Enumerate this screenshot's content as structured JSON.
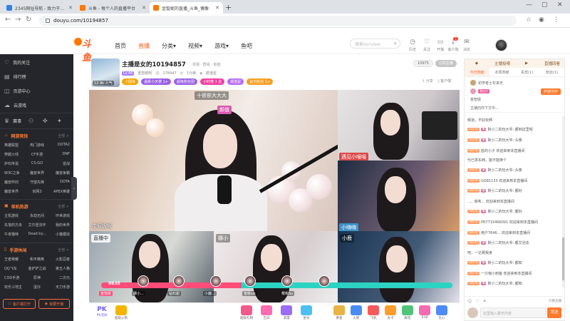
{
  "browser": {
    "tabs": [
      {
        "title": "2345网址导航 - 致力于打造百年品牌",
        "favicon_color": "#2f83e6"
      },
      {
        "title": "斗鱼 - 每个人的直播平台",
        "favicon_color": "#ff7700"
      },
      {
        "title": "金智妮的直播_斗鱼_偶像",
        "favicon_color": "#ff7700"
      }
    ],
    "active_tab": 2,
    "url": "douyu.com/10194857",
    "new_tab": "+"
  },
  "site": {
    "logo": "斗鱼",
    "nav": [
      "首页",
      "直播",
      "分类",
      "视频",
      "游戏",
      "鱼吧"
    ],
    "active_nav": 1,
    "search_placeholder": "搜索ourview",
    "header_icons": [
      "历史",
      "关注",
      "开播",
      "客户端",
      "消息"
    ],
    "msg_badge": "1"
  },
  "sidebar": {
    "top_items": [
      {
        "label": "我的关注",
        "icon": "heart-icon"
      },
      {
        "label": "排行榜",
        "icon": "rank-icon"
      },
      {
        "label": "页游中心",
        "icon": "gamepad-icon"
      },
      {
        "label": "云游戏",
        "icon": "cloud-icon"
      }
    ],
    "event_items": [
      "赛事",
      "",
      "",
      ""
    ],
    "categories": [
      {
        "title": "网游竞技",
        "more": "全部 >",
        "items": [
          "英雄联盟",
          "热门游戏",
          "DOTA2",
          "穿越火线",
          "CF手游",
          "DNF",
          "炉石传说",
          "CS:GO",
          "逆战",
          "W3C之争",
          "魔兽世界",
          "魔兽争霸",
          "魔兽怀旧",
          "守望先锋",
          "DOTA",
          "魔兽世界",
          "剑网3",
          "APEX英雄"
        ]
      },
      {
        "title": "单机热游",
        "more": "全部 >",
        "items": [
          "主机游戏",
          "永劫无间",
          "环世游戏",
          "失落的方舟",
          "艾尔登法环",
          "我的世界",
          "午夜猫咪",
          "Dead by...",
          "小猫模拟"
        ]
      },
      {
        "title": "手游休闲",
        "more": "全部 >",
        "items": [
          "王者荣耀",
          "和平精英",
          "火影忍者",
          "QQ飞车",
          "金铲铲之战",
          "第五人格",
          "COD手游",
          "原神",
          "二次元",
          "欢乐斗地主",
          "蛋仔",
          "天刀手游"
        ]
      }
    ],
    "buttons": [
      "客户端打开",
      "我要开播"
    ]
  },
  "room": {
    "anchor_tag": "12.9k 人气",
    "title": "主播是女的10194857",
    "links": [
      "举报",
      "群组",
      "颜值"
    ],
    "level": "Lv.46",
    "meta": [
      "金智妮呢",
      "278447",
      "1分钟",
      "颜值星"
    ],
    "tags": [
      {
        "label": "小团体",
        "color": "#f7a400"
      },
      {
        "label": "温柔小天使 1+",
        "color": "#9b62e6"
      },
      {
        "label": "超级粉丝团",
        "color": "#9b62e6"
      },
      {
        "label": "小时榜 1 名",
        "color": "#ef3fa0"
      },
      {
        "label": "颜值星",
        "color": "#b86af5"
      },
      {
        "label": "钻石粉丝 1+",
        "color": "#f5a021"
      }
    ],
    "right_pills": [
      "10975",
      "订阅主播"
    ],
    "actions": [
      "分享",
      "客户端",
      "举报"
    ]
  },
  "video": {
    "main_banner": "十依依大大大",
    "main_badge": "颜值",
    "main_label": "金智妮呢",
    "cell_labels": [
      "遇见小喵喵",
      "小嗨嗨",
      "直播中",
      "娜小",
      "小鹿",
      "小金"
    ],
    "pk_score": "8628",
    "pk_names": [
      "金智妮",
      "娜小...",
      "钻石甜",
      "小鹿...",
      "蜜桃sis",
      "樱桃Su"
    ]
  },
  "gifts": {
    "pk_label": "PK",
    "pk_sub": "PK活动",
    "items": [
      {
        "label": "超级火箭",
        "color": "#f6b400"
      },
      {
        "label": "超级礼物",
        "color": "#f25a8c"
      },
      {
        "label": "告白",
        "color": "#ff6bb0"
      },
      {
        "label": "浪漫",
        "color": "#9b6cf5"
      },
      {
        "label": "星光",
        "color": "#4cc0f1"
      },
      {
        "label": "黄金",
        "color": "#e8b245"
      },
      {
        "label": "火箭",
        "color": "#4a8cf5"
      },
      {
        "label": "飞机",
        "color": "#f55a5a"
      },
      {
        "label": "办卡",
        "color": "#ff9d2b"
      },
      {
        "label": "鲜花",
        "color": "#52c47a"
      },
      {
        "label": "618",
        "color": "#f56bb0"
      },
      {
        "label": "比心",
        "color": "#4f8bf7"
      },
      {
        "label": "更多",
        "color": "#ccc"
      }
    ]
  },
  "rpanel": {
    "top": [
      "主播投喂",
      "直播回看"
    ],
    "tabs": [
      "今日贡献",
      "本周贡献",
      "贵宾(1)",
      "粉丝(1)"
    ],
    "active_tab": 0,
    "rank_rows": [
      "初学者士年来无",
      "潘宝贝",
      "金智妮",
      "主播向你下方中..."
    ],
    "open_guard": "开通守护",
    "messages": [
      {
        "lv": "",
        "med": "",
        "name": "",
        "text": "频道，不好玩啊"
      },
      {
        "lv": "12/35",
        "med": "",
        "name": "",
        "text": "默小二的玩大爷: 都到这里啦"
      },
      {
        "lv": "18/35",
        "med": "",
        "name": "",
        "text": "默小二的玩大爷: 头像"
      },
      {
        "lv": "18/35",
        "med": "",
        "name": "",
        "text": "蓝的小子 欢迎来到本直播间"
      },
      {
        "lv": "",
        "med": "",
        "name": "",
        "text": "代已羡东西，能不能换个"
      },
      {
        "lv": "18/35",
        "med": "",
        "name": "",
        "text": "默小二的玩大爷: 头像"
      },
      {
        "lv": "18/35",
        "med": "",
        "name": "",
        "text": "GG81133 欢迎来到本直播间"
      },
      {
        "lv": "18/35",
        "med": "",
        "name": "",
        "text": "默小二的玩大爷: 都好"
      },
      {
        "lv": "",
        "med": "",
        "name": "",
        "text": "..... 真希... 欢迎来到本直播间"
      },
      {
        "lv": "18/35",
        "med": "",
        "name": "",
        "text": "默小二的玩大爷: 都好"
      },
      {
        "lv": "18/35",
        "med": "",
        "name": "",
        "text": "PR7715466091 欢迎来到本直播间"
      },
      {
        "lv": "18/35",
        "med": "",
        "name": "",
        "text": "用户7646... 欢迎来到本直播间"
      },
      {
        "lv": "18/35",
        "med": "",
        "name": "",
        "text": "默小二的玩大爷: 都艾治去"
      },
      {
        "lv": "",
        "med": "",
        "name": "",
        "text": "吧，一达那我身"
      },
      {
        "lv": "18/35",
        "med": "",
        "name": "",
        "text": "默小二的玩大爷: 都知"
      },
      {
        "lv": "18/35",
        "med": "",
        "name": "",
        "text": "一只咖小刺客 欢迎来到本直播间"
      },
      {
        "lv": "18/35",
        "med": "",
        "name": "",
        "text": "默小二的玩大爷: 都知"
      }
    ],
    "block_label": "只看主播",
    "input_placeholder": "这里输入聊天内容",
    "send_label": "发送"
  }
}
